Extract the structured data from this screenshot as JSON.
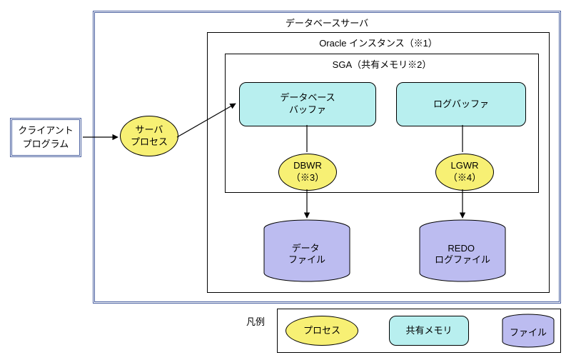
{
  "diagram": {
    "db_server_title": "データベースサーバ",
    "client_program_line1": "クライアント",
    "client_program_line2": "プログラム",
    "server_process_line1": "サーバ",
    "server_process_line2": "プロセス",
    "oracle_instance_title": "Oracle インスタンス（※1）",
    "sga_title": "SGA（共有メモリ※2）",
    "db_buffer_line1": "データベース",
    "db_buffer_line2": "バッファ",
    "log_buffer": "ログバッファ",
    "dbwr_line1": "DBWR",
    "dbwr_line2": "（※3）",
    "lgwr_line1": "LGWR",
    "lgwr_line2": "（※4）",
    "data_file_line1": "データ",
    "data_file_line2": "ファイル",
    "redo_file_line1": "REDO",
    "redo_file_line2": "ログファイル",
    "legend_title": "凡例",
    "legend_process": "プロセス",
    "legend_mem": "共有メモリ",
    "legend_file": "ファイル"
  }
}
